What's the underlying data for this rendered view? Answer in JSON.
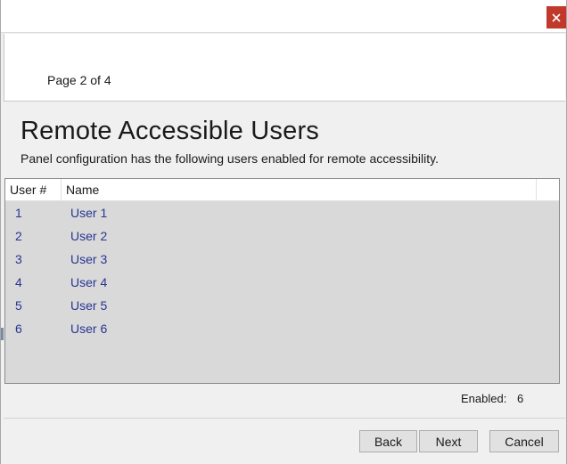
{
  "window": {
    "page_indicator": "Page 2 of 4"
  },
  "main": {
    "heading": "Remote Accessible Users",
    "subheading": "Panel configuration has the following users enabled for remote accessibility."
  },
  "table": {
    "columns": [
      "User #",
      "Name"
    ],
    "rows": [
      {
        "num": "1",
        "name": "User 1"
      },
      {
        "num": "2",
        "name": "User 2"
      },
      {
        "num": "3",
        "name": "User 3"
      },
      {
        "num": "4",
        "name": "User 4"
      },
      {
        "num": "5",
        "name": "User 5"
      },
      {
        "num": "6",
        "name": "User 6"
      }
    ]
  },
  "summary": {
    "enabled_label": "Enabled:",
    "enabled_count": "6"
  },
  "footer": {
    "back_label": "Back",
    "next_label": "Next",
    "cancel_label": "Cancel"
  },
  "colors": {
    "close_button": "#c0392b",
    "row_text": "#283593",
    "list_background": "#d9d9d9"
  },
  "icons": {
    "close": "close-icon"
  }
}
